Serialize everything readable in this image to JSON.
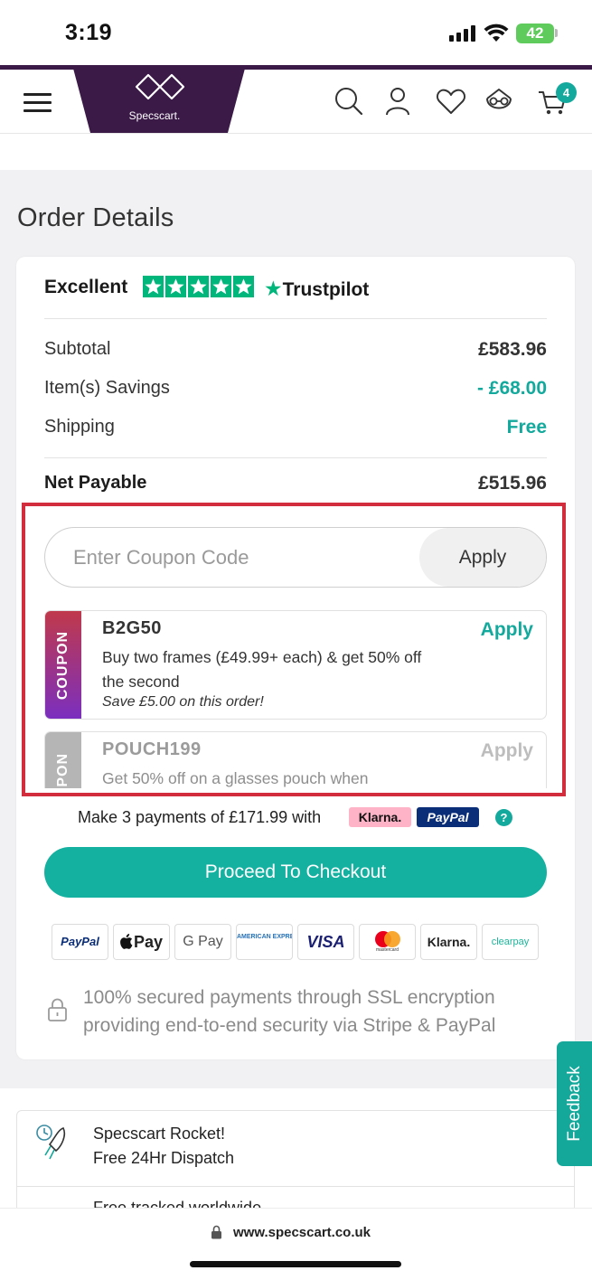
{
  "status_bar": {
    "time": "3:19",
    "battery": "42"
  },
  "header": {
    "logo_text": "Specscart.",
    "cart_count": "4"
  },
  "order": {
    "title": "Order Details",
    "trustpilot": {
      "rating_word": "Excellent",
      "brand": "Trustpilot",
      "stars": 5
    },
    "rows": [
      {
        "label": "Subtotal",
        "value": "£583.96"
      },
      {
        "label": "Item(s) Savings",
        "value": "- £68.00"
      },
      {
        "label": "Shipping",
        "value": "Free"
      }
    ],
    "net": {
      "label": "Net Payable",
      "value": "£515.96"
    }
  },
  "coupon": {
    "placeholder": "Enter Coupon Code",
    "apply_label": "Apply",
    "offers": [
      {
        "tab": "COUPON",
        "code": "B2G50",
        "apply": "Apply",
        "description": "Buy two frames (£49.99+ each) & get 50% off the second",
        "save_note": "Save £5.00 on this order!"
      },
      {
        "tab": "COUPON",
        "code": "POUCH199",
        "apply": "Apply",
        "description": "Get 50% off on a glasses pouch when"
      }
    ]
  },
  "pay_later": {
    "text": "Make 3 payments of £171.99 with",
    "klarna": "Klarna.",
    "paypal": "PayPal",
    "help": "?"
  },
  "checkout": {
    "label": "Proceed To Checkout"
  },
  "payment_methods": [
    "PayPal",
    "Pay",
    "G Pay",
    "AMERICAN EXPRESS",
    "VISA",
    "mastercard",
    "Klarna.",
    "clearpay"
  ],
  "secure_note": "100% secured payments through SSL encryption providing end-to-end security via Stripe & PayPal",
  "features": [
    {
      "title": "Specscart Rocket!",
      "subtitle": "Free 24Hr Dispatch"
    },
    {
      "title": "Free tracked worldwide"
    }
  ],
  "feedback": {
    "label": "Feedback"
  },
  "browser": {
    "url": "www.specscart.co.uk"
  },
  "colors": {
    "brand_purple": "#3b1a48",
    "accent_teal": "#13a99c",
    "highlight_red": "#d22d3c",
    "coupon_tab_red": "#c0394b",
    "coupon_tab_purple": "#7b2fbf"
  }
}
